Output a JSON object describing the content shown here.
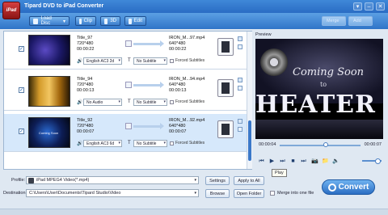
{
  "window": {
    "logo_text": "iPad",
    "title": "Tipard DVD to iPad Converter",
    "buttons": [
      "▾",
      "–",
      "✕"
    ]
  },
  "toolbar": {
    "load_disc": "Load Disc",
    "load_disc_dd": "▾",
    "clip": "Clip",
    "three_d": "3D",
    "edit": "Edit",
    "merge": "Merge",
    "add": "Add"
  },
  "files": [
    {
      "title": "Title_97",
      "resolution": "720*480",
      "duration": "00:00:22",
      "output_name": "IRON_M...97.mp4",
      "output_resolution": "640*480",
      "output_duration": "00:00:22",
      "audio": "English AC3 2d",
      "subtitle": "No Subtitle",
      "forced": "Forced Subtitles",
      "selected": false
    },
    {
      "title": "Title_94",
      "resolution": "720*480",
      "duration": "00:00:13",
      "output_name": "IRON_M...94.mp4",
      "output_resolution": "640*480",
      "output_duration": "00:00:13",
      "audio": "No Audio",
      "subtitle": "No Subtitle",
      "forced": "Forced Subtitles",
      "selected": false
    },
    {
      "title": "Title_92",
      "resolution": "720*480",
      "duration": "00:00:07",
      "output_name": "IRON_M...92.mp4",
      "output_resolution": "640*480",
      "output_duration": "00:00:07",
      "audio": "English AC3 6d",
      "subtitle": "No Subtitle",
      "forced": "Forced Subtitles",
      "selected": true,
      "thumb_caption": "Coming Soon"
    }
  ],
  "preview": {
    "label": "Preview",
    "line1": "Coming Soon",
    "line2": "to",
    "line3": "HEATER",
    "time_current": "00:00:04",
    "time_total": "00:00:07",
    "position_fraction": 0.57
  },
  "controls": {
    "prev": "⏮",
    "play": "▶",
    "next": "⏭",
    "stop": "■",
    "end": "⏭",
    "snapshot": "📷",
    "folder": "📁",
    "volume": "🔈",
    "tooltip": "Play"
  },
  "bottom": {
    "profile_label": "Profile:",
    "profile_value": "iPad MPEG4 Video(*.mp4)",
    "settings": "Settings",
    "apply_all": "Apply to All",
    "destination_label": "Destination:",
    "destination_value": "C:\\Users\\User\\Documents\\Tipard Studio\\Video",
    "browse": "Browse",
    "open_folder": "Open Folder",
    "merge_label": "Merge into one file",
    "convert": "Convert"
  }
}
